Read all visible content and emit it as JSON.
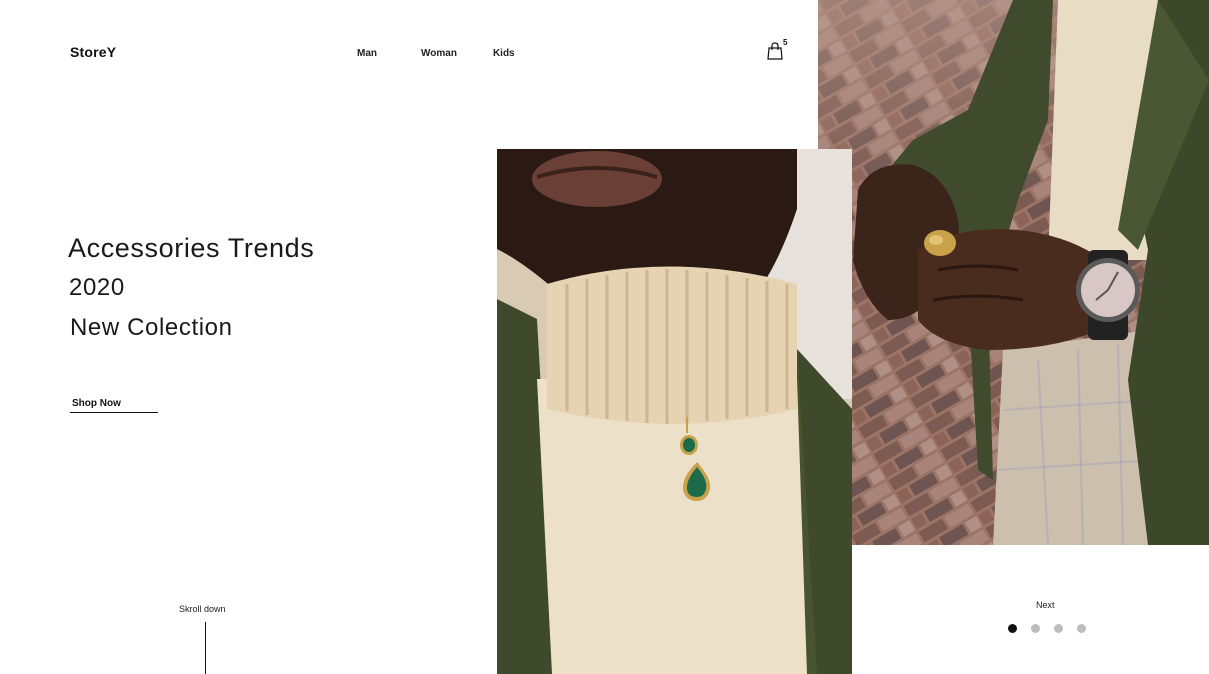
{
  "brand": {
    "logo": "StoreY"
  },
  "nav": {
    "items": [
      {
        "label": "Man"
      },
      {
        "label": "Woman"
      },
      {
        "label": "Kids"
      }
    ]
  },
  "cart": {
    "count": "5",
    "icon": "shopping-bag-icon"
  },
  "hero": {
    "title": "Accessories Trends",
    "year": "2020",
    "subtitle": "New Colection",
    "cta": "Shop Now"
  },
  "scroll": {
    "label": "Skroll down"
  },
  "slider": {
    "next_label": "Next",
    "total_slides": 4,
    "active_index": 0
  },
  "colors": {
    "text": "#111111",
    "jacket_green": "#3e4a2b",
    "sweater_cream": "#ece0c8",
    "brick": "#9a6e5f",
    "pendant_green": "#1b6b4a",
    "gold": "#c8a24a",
    "dot_inactive": "#bdbdbd"
  }
}
